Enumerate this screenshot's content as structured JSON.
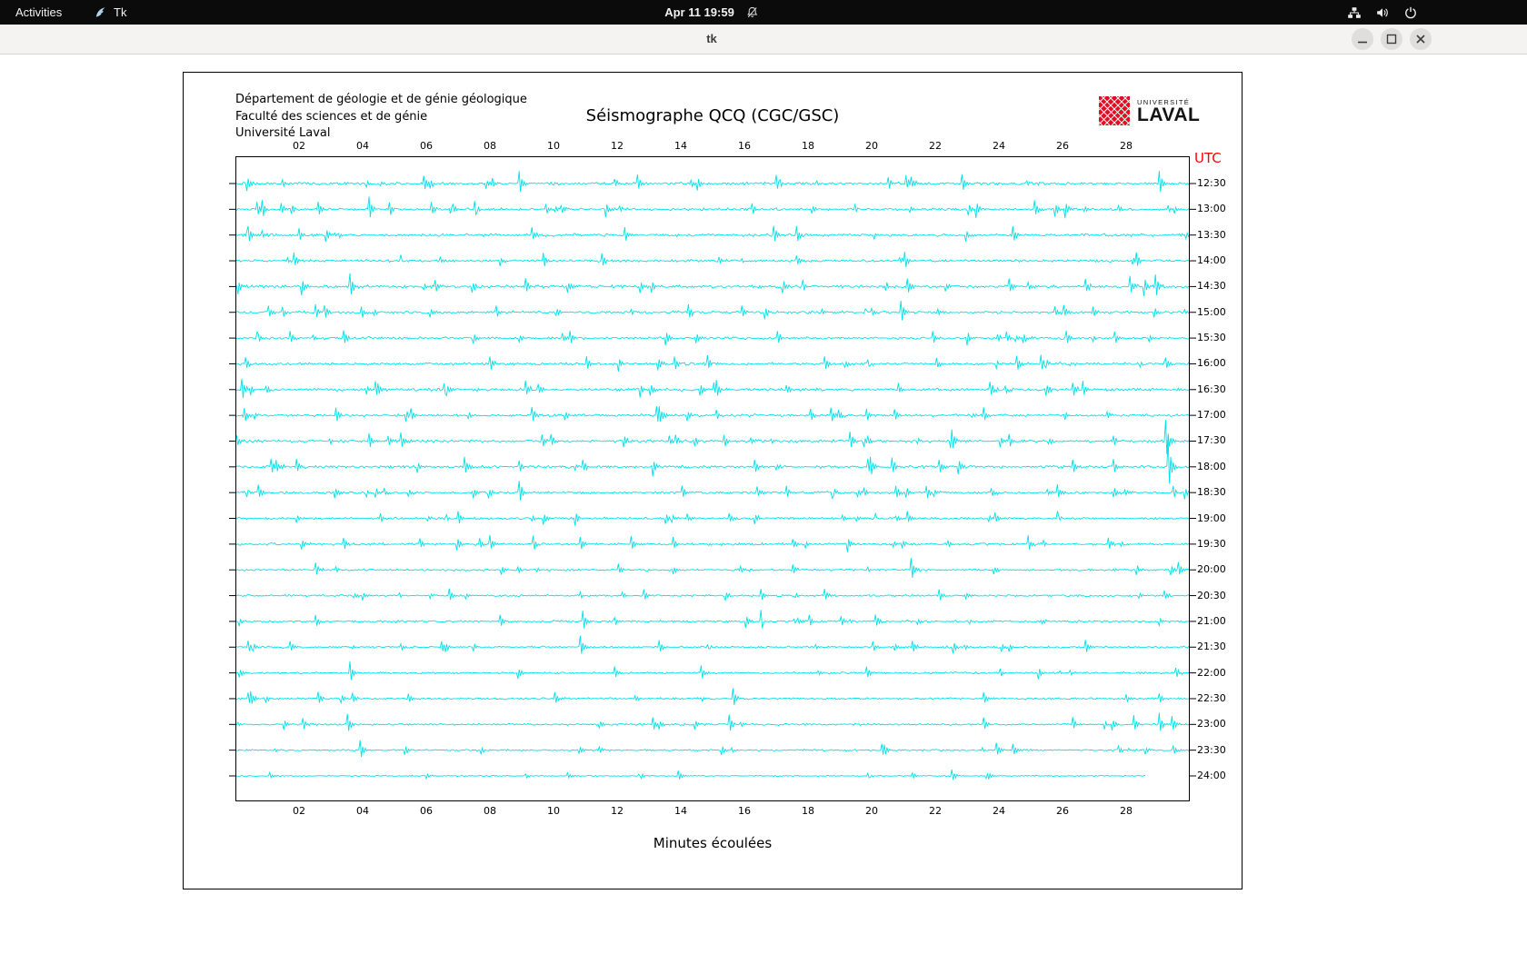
{
  "top_bar": {
    "activities_label": "Activities",
    "app_name": "Tk",
    "clock": "Apr 11 19:59"
  },
  "window": {
    "title": "tk"
  },
  "seismograph": {
    "header_lines": [
      "Département de géologie et de génie géologique",
      "Faculté des sciences et de génie",
      "Université Laval"
    ],
    "title": "Séismographe QCQ (CGC/GSC)",
    "utc_label": "UTC",
    "x_axis_label": "Minutes écoulées",
    "logo": {
      "line1": "UNIVERSITÉ",
      "line2": "LAVAL"
    },
    "colors": {
      "trace": "#00e1ea",
      "utc": "#ff0000",
      "logo_red": "#e30c22"
    }
  },
  "chart_data": {
    "type": "line",
    "subtype": "seismogram-helicorder",
    "title": "Séismographe QCQ (CGC/GSC)",
    "xlabel": "Minutes écoulées",
    "right_axis_label": "UTC",
    "x_range_minutes": [
      0,
      30
    ],
    "x_ticks": [
      "02",
      "04",
      "06",
      "08",
      "10",
      "12",
      "14",
      "16",
      "18",
      "20",
      "22",
      "24",
      "26",
      "28"
    ],
    "rows": [
      {
        "label": "12:30",
        "activity": 1.1,
        "events": [
          [
            5.9,
            10
          ],
          [
            8.9,
            13
          ],
          [
            12.6,
            9
          ],
          [
            20.5,
            8
          ],
          [
            22.8,
            10
          ],
          [
            29.0,
            14
          ]
        ]
      },
      {
        "label": "13:00",
        "activity": 1.0,
        "events": [
          [
            0.8,
            9
          ],
          [
            4.2,
            14
          ],
          [
            7.5,
            9
          ],
          [
            16.2,
            7
          ],
          [
            25.1,
            10
          ]
        ]
      },
      {
        "label": "13:30",
        "activity": 1.1,
        "events": [
          [
            0.4,
            13
          ],
          [
            12.2,
            9
          ],
          [
            16.9,
            10
          ],
          [
            17.6,
            10
          ],
          [
            21.6,
            7
          ],
          [
            24.4,
            9
          ]
        ]
      },
      {
        "label": "14:00",
        "activity": 1.0,
        "events": [
          [
            1.8,
            9
          ],
          [
            5.2,
            7
          ],
          [
            11.5,
            8
          ],
          [
            21.0,
            9
          ],
          [
            28.3,
            10
          ]
        ]
      },
      {
        "label": "14:30",
        "activity": 1.15,
        "events": [
          [
            3.6,
            14
          ],
          [
            9.1,
            10
          ],
          [
            17.8,
            7
          ],
          [
            21.1,
            9
          ],
          [
            24.3,
            9
          ],
          [
            26.7,
            9
          ],
          [
            28.1,
            12
          ],
          [
            28.9,
            13
          ]
        ]
      },
      {
        "label": "15:00",
        "activity": 1.0,
        "events": [
          [
            2.5,
            9
          ],
          [
            8.2,
            7
          ],
          [
            14.2,
            9
          ],
          [
            20.9,
            13
          ],
          [
            26.0,
            8
          ]
        ]
      },
      {
        "label": "15:30",
        "activity": 0.95,
        "events": [
          [
            1.7,
            8
          ],
          [
            3.4,
            9
          ],
          [
            10.5,
            8
          ],
          [
            17.0,
            9
          ],
          [
            21.9,
            8
          ],
          [
            24.2,
            7
          ],
          [
            26.1,
            8
          ]
        ]
      },
      {
        "label": "16:00",
        "activity": 1.05,
        "events": [
          [
            0.3,
            8
          ],
          [
            8.0,
            9
          ],
          [
            14.8,
            9
          ],
          [
            18.5,
            9
          ],
          [
            22.0,
            7
          ],
          [
            25.3,
            10
          ]
        ]
      },
      {
        "label": "16:30",
        "activity": 1.1,
        "events": [
          [
            0.2,
            13
          ],
          [
            4.4,
            9
          ],
          [
            9.1,
            9
          ],
          [
            15.0,
            8
          ],
          [
            20.8,
            7
          ],
          [
            23.7,
            10
          ],
          [
            26.6,
            9
          ]
        ]
      },
      {
        "label": "17:00",
        "activity": 1.0,
        "events": [
          [
            5.5,
            9
          ],
          [
            9.3,
            9
          ],
          [
            13.2,
            10
          ],
          [
            18.7,
            9
          ],
          [
            19.8,
            7
          ],
          [
            23.5,
            8
          ]
        ]
      },
      {
        "label": "17:30",
        "activity": 1.05,
        "events": [
          [
            4.2,
            9
          ],
          [
            5.2,
            10
          ],
          [
            9.9,
            8
          ],
          [
            13.8,
            7
          ],
          [
            19.3,
            10
          ],
          [
            22.5,
            8
          ],
          [
            24.3,
            7
          ],
          [
            29.2,
            24
          ]
        ]
      },
      {
        "label": "18:00",
        "activity": 1.05,
        "events": [
          [
            1.1,
            9
          ],
          [
            1.9,
            8
          ],
          [
            7.2,
            11
          ],
          [
            16.3,
            8
          ],
          [
            20.6,
            9
          ],
          [
            22.1,
            8
          ],
          [
            29.3,
            30
          ]
        ]
      },
      {
        "label": "18:30",
        "activity": 0.9,
        "events": [
          [
            0.7,
            8
          ],
          [
            8.9,
            13
          ],
          [
            14.0,
            8
          ],
          [
            17.3,
            7
          ],
          [
            21.7,
            8
          ],
          [
            25.8,
            8
          ]
        ]
      },
      {
        "label": "19:00",
        "activity": 0.85,
        "events": [
          [
            7.0,
            8
          ],
          [
            15.5,
            6
          ],
          [
            21.1,
            8
          ],
          [
            25.8,
            8
          ]
        ]
      },
      {
        "label": "19:30",
        "activity": 0.95,
        "events": [
          [
            3.4,
            8
          ],
          [
            8.0,
            9
          ],
          [
            10.8,
            8
          ],
          [
            17.5,
            6
          ],
          [
            24.9,
            9
          ],
          [
            27.4,
            8
          ]
        ]
      },
      {
        "label": "20:00",
        "activity": 0.85,
        "events": [
          [
            2.5,
            8
          ],
          [
            12.0,
            6
          ],
          [
            17.5,
            6
          ],
          [
            21.2,
            13
          ],
          [
            29.6,
            9
          ]
        ]
      },
      {
        "label": "20:30",
        "activity": 0.8,
        "events": [
          [
            6.7,
            8
          ],
          [
            12.8,
            7
          ],
          [
            16.5,
            7
          ],
          [
            18.5,
            7
          ],
          [
            22.1,
            7
          ]
        ]
      },
      {
        "label": "21:00",
        "activity": 0.85,
        "events": [
          [
            2.5,
            7
          ],
          [
            8.3,
            8
          ],
          [
            10.9,
            12
          ],
          [
            16.5,
            12
          ],
          [
            18.0,
            7
          ],
          [
            20.1,
            8
          ]
        ]
      },
      {
        "label": "21:30",
        "activity": 0.8,
        "events": [
          [
            0.4,
            7
          ],
          [
            1.7,
            7
          ],
          [
            10.8,
            13
          ],
          [
            13.3,
            8
          ],
          [
            20.0,
            6
          ],
          [
            26.7,
            8
          ]
        ]
      },
      {
        "label": "22:00",
        "activity": 0.75,
        "events": [
          [
            3.6,
            12
          ],
          [
            11.9,
            7
          ],
          [
            14.6,
            8
          ],
          [
            19.8,
            7
          ],
          [
            24.0,
            5
          ]
        ]
      },
      {
        "label": "22:30",
        "activity": 0.78,
        "events": [
          [
            0.4,
            7
          ],
          [
            2.6,
            7
          ],
          [
            10.0,
            7
          ],
          [
            15.6,
            12
          ],
          [
            23.5,
            7
          ],
          [
            29.0,
            6
          ]
        ]
      },
      {
        "label": "23:00",
        "activity": 0.75,
        "events": [
          [
            2.1,
            7
          ],
          [
            3.5,
            12
          ],
          [
            13.1,
            8
          ],
          [
            15.5,
            11
          ],
          [
            23.5,
            7
          ],
          [
            26.3,
            7
          ],
          [
            28.2,
            10
          ],
          [
            29.0,
            12
          ],
          [
            29.4,
            9
          ]
        ]
      },
      {
        "label": "23:30",
        "activity": 0.7,
        "events": [
          [
            3.9,
            11
          ],
          [
            20.3,
            7
          ],
          [
            23.9,
            8
          ],
          [
            24.4,
            7
          ]
        ]
      },
      {
        "label": "24:00",
        "activity": 0.45,
        "end_min": 28.6,
        "events": [
          [
            13.9,
            6
          ],
          [
            22.5,
            7
          ]
        ]
      }
    ]
  }
}
